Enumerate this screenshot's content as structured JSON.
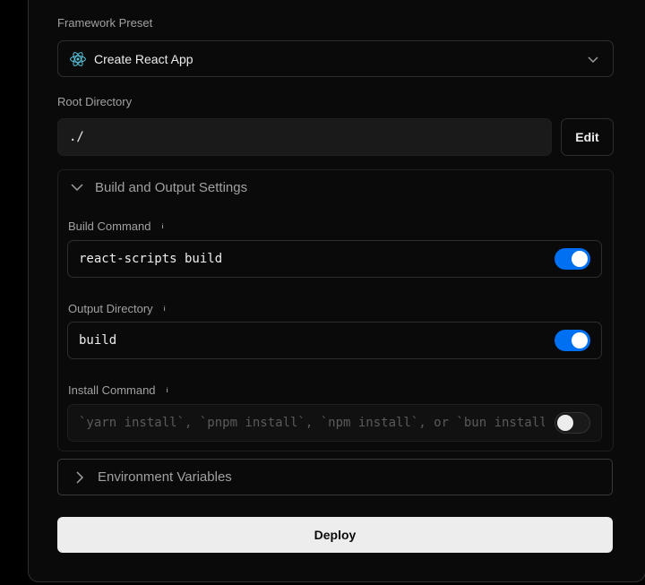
{
  "framework": {
    "label": "Framework Preset",
    "selected": "Create React App"
  },
  "root": {
    "label": "Root Directory",
    "value": "./",
    "edit_label": "Edit"
  },
  "build_settings": {
    "title": "Build and Output Settings",
    "build_command": {
      "label": "Build Command",
      "value": "react-scripts build",
      "override": true
    },
    "output_directory": {
      "label": "Output Directory",
      "value": "build",
      "override": true
    },
    "install_command": {
      "label": "Install Command",
      "placeholder": "`yarn install`, `pnpm install`, `npm install`, or `bun install`",
      "override": false
    },
    "info_glyph": "i"
  },
  "env": {
    "title": "Environment Variables"
  },
  "deploy": {
    "label": "Deploy"
  },
  "colors": {
    "accent": "#0070f3",
    "react": "#58c4dc"
  }
}
